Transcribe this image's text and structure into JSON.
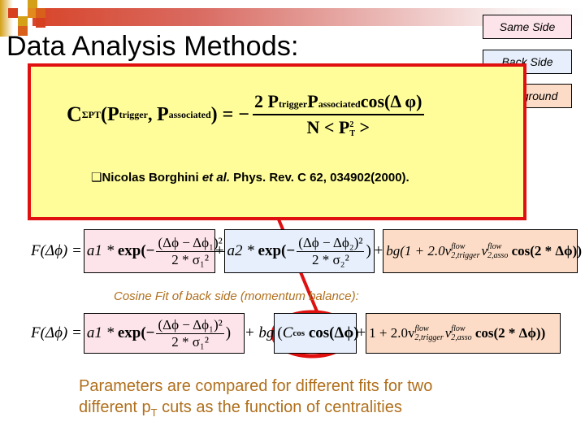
{
  "slide": {
    "title": "Data Analysis Methods:",
    "legend": {
      "same_side": "Same Side",
      "back_side": "Back Side",
      "background": "Background",
      "colors": {
        "same_side": "#fde4ea",
        "back_side": "#e6effb",
        "background": "#fcdcc6"
      }
    },
    "highlight_box": {
      "formula": {
        "lhs_symbol": "C",
        "lhs_superscript": "ΣPT",
        "lhs_args_open": "(",
        "arg1": "P",
        "arg1_sub": "trigger",
        "arg_sep": ", ",
        "arg2": "P",
        "arg2_sub": "associated",
        "lhs_args_close": ")",
        "equals": " = −",
        "numerator_coef": "2 ",
        "numerator_p1": "P",
        "numerator_p1_sub": "trigger",
        "numerator_p2": "P",
        "numerator_p2_sub": "associated",
        "numerator_cos": "cos(Δ φ)",
        "denominator_n": "N < ",
        "denominator_p": "P",
        "denominator_p_sup": "2",
        "denominator_p_sub": "T",
        "denominator_close": " >"
      },
      "reference_bullet": "❑",
      "reference_author": "Nicolas Borghini ",
      "reference_etal": "et al.",
      "reference_journal": " Phys. Rev. C 62, 034902(2000).",
      "border_color": "#e01010",
      "fill_color": "#fffd99"
    },
    "fit1": {
      "lhs": "F(Δϕ) =",
      "same_side_term": {
        "a": "a1 * ",
        "exp": "exp(−",
        "num": "(Δϕ − Δϕ₁)²",
        "den": "2 * σ₁²",
        "close": ")"
      },
      "plus1": "+",
      "back_side_term": {
        "a": "a2 * ",
        "exp": "exp(−",
        "num": "(Δϕ − Δϕ₂)²",
        "den": "2 * σ₂²",
        "close": ")"
      },
      "plus2": "+",
      "background_term": {
        "prefix": "bg(1 + 2.0v",
        "v1_sup": "flow",
        "v1_sub": "2,trigger",
        "v2": "v",
        "v2_sup": "flow",
        "v2_sub": "2,asso",
        "cos": " cos(2 * Δϕ))"
      }
    },
    "caption": "Cosine Fit of back side (momentum balance):",
    "fit2": {
      "lhs": "F(Δϕ) =",
      "same_side_term": {
        "a": "a1 * ",
        "exp": "exp(−",
        "num": "(Δϕ − Δϕ₁)²",
        "den": "2 * σ₁²",
        "close": ")"
      },
      "plus1": "+ bg",
      "back_side_term": {
        "open": "(",
        "c": "C",
        "c_sub": "cos",
        "cos": " cos(Δϕ)"
      },
      "plus2": "+",
      "background_term": {
        "prefix": "1 + 2.0v",
        "v1_sup": "flow",
        "v1_sub": "2,trigger",
        "v2": "v",
        "v2_sup": "flow",
        "v2_sub": "2,asso",
        "cos": " cos(2 * Δϕ))"
      }
    },
    "summary_line1": "Parameters are compared for different fits for two",
    "summary_line2_a": "different p",
    "summary_line2_sub": "T",
    "summary_line2_b": " cuts as the function of centralities",
    "text_accent_color": "#b06f1c"
  }
}
